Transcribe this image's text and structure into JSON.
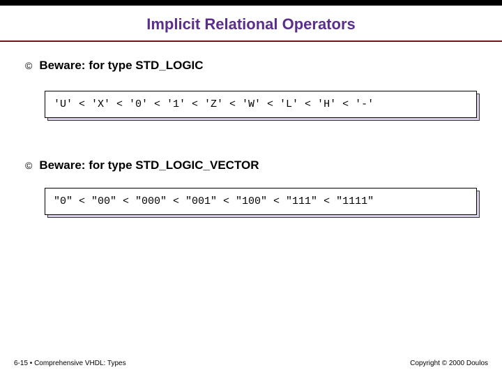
{
  "title": "Implicit Relational Operators",
  "bullets": [
    {
      "icon": "©",
      "text": "Beware: for type STD_LOGIC"
    },
    {
      "icon": "©",
      "text": "Beware: for type STD_LOGIC_VECTOR"
    }
  ],
  "codeboxes": [
    {
      "code": "'U' < 'X' < '0' < '1' < 'Z' < 'W' < 'L' < 'H' < '-'"
    },
    {
      "code": "\"0\" < \"00\" < \"000\" < \"001\" < \"100\" < \"111\" < \"1111\""
    }
  ],
  "footer": {
    "left": "6-15  •  Comprehensive VHDL: Types",
    "right": "Copyright © 2000 Doulos"
  }
}
